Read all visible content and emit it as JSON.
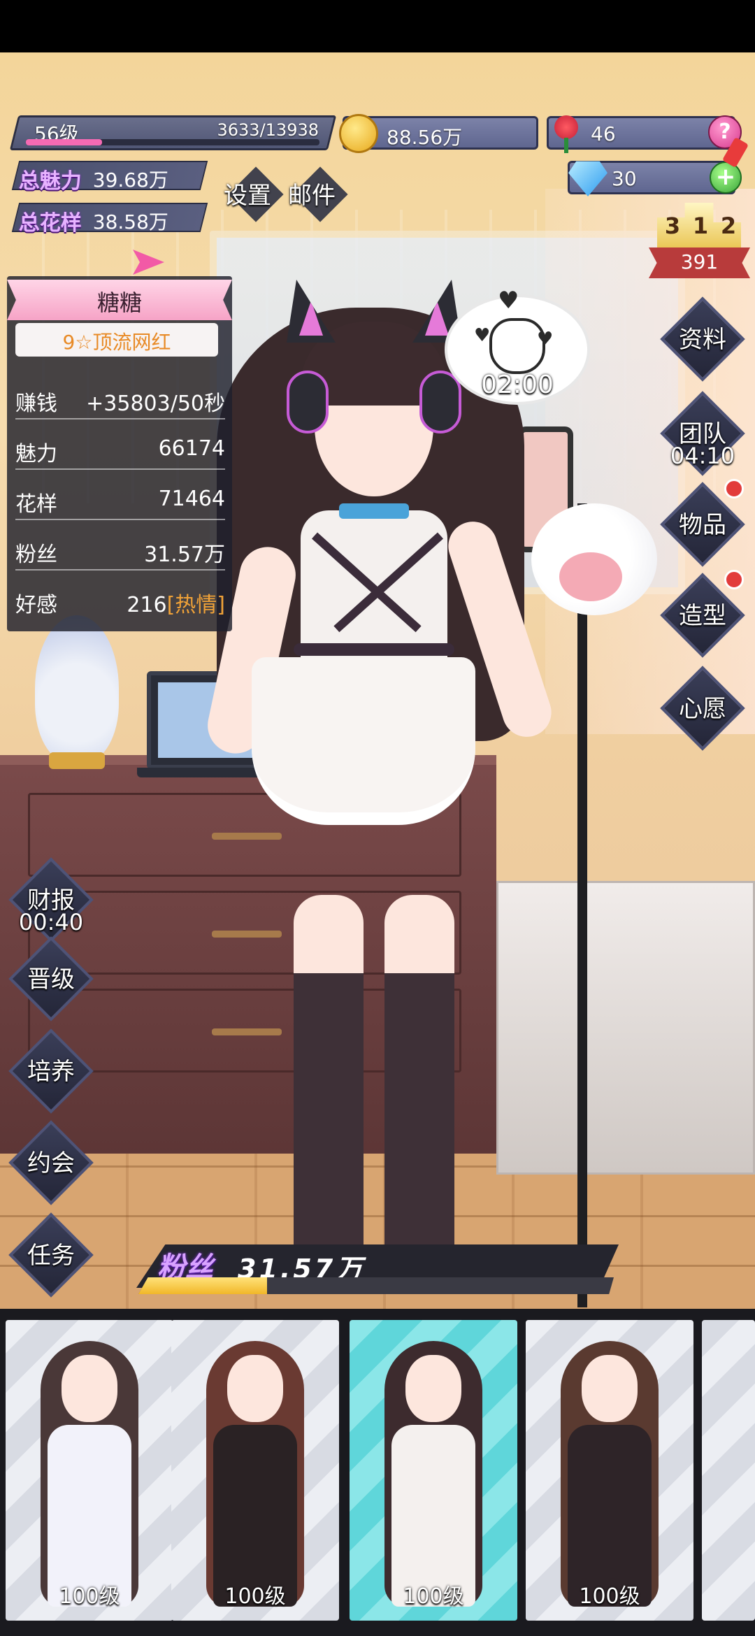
{
  "player": {
    "level": "56级",
    "xp": "3633/13938",
    "xp_fraction": 0.26
  },
  "resources": {
    "coins": "88.56万",
    "roses": "46",
    "diamonds": "30"
  },
  "totals": {
    "charm_label": "总魅力",
    "charm_value": "39.68万",
    "style_label": "总花样",
    "style_value": "38.58万"
  },
  "top_menu": {
    "settings": "设置",
    "mail": "邮件"
  },
  "rank": {
    "podium": [
      "3",
      "1",
      "2"
    ],
    "value": "391"
  },
  "character": {
    "name": "糖糖",
    "title": "9☆顶流网红",
    "stats": [
      {
        "key": "赚钱",
        "value": "+35803/50秒"
      },
      {
        "key": "魅力",
        "value": "66174"
      },
      {
        "key": "花样",
        "value": "71464"
      },
      {
        "key": "粉丝",
        "value": "31.57万"
      }
    ],
    "affection_key": "好感",
    "affection_value": "216",
    "affection_state": "[热情]"
  },
  "bubble": {
    "timer": "02:00"
  },
  "right_buttons": [
    {
      "label": "资料",
      "sub": "",
      "alert": false
    },
    {
      "label": "团队",
      "sub": "04:10",
      "alert": false
    },
    {
      "label": "物品",
      "sub": "",
      "alert": true
    },
    {
      "label": "造型",
      "sub": "",
      "alert": true
    },
    {
      "label": "心愿",
      "sub": "",
      "alert": false
    }
  ],
  "left_buttons": [
    {
      "label": "财报",
      "sub": "00:40"
    },
    {
      "label": "晋级",
      "sub": ""
    },
    {
      "label": "培养",
      "sub": ""
    },
    {
      "label": "约会",
      "sub": ""
    },
    {
      "label": "任务",
      "sub": ""
    }
  ],
  "fans": {
    "label": "粉丝",
    "value": "31.57万",
    "fraction": 0.27
  },
  "roster": [
    {
      "level": "100级",
      "active": false,
      "hair": "#4a3838",
      "outfit": "#f2f2fa"
    },
    {
      "level": "100级",
      "active": false,
      "hair": "#6a3a32",
      "outfit": "#2a2224"
    },
    {
      "level": "100级",
      "active": true,
      "hair": "#3d2b2e",
      "outfit": "#f4f0ee"
    },
    {
      "level": "100级",
      "active": false,
      "hair": "#5a3a30",
      "outfit": "#2e2428"
    }
  ],
  "colors": {
    "accent_pink": "#f46ab3",
    "fans_gold": "#f1b728",
    "alert_red": "#e23b3b",
    "active_card": "#5fd6da"
  }
}
